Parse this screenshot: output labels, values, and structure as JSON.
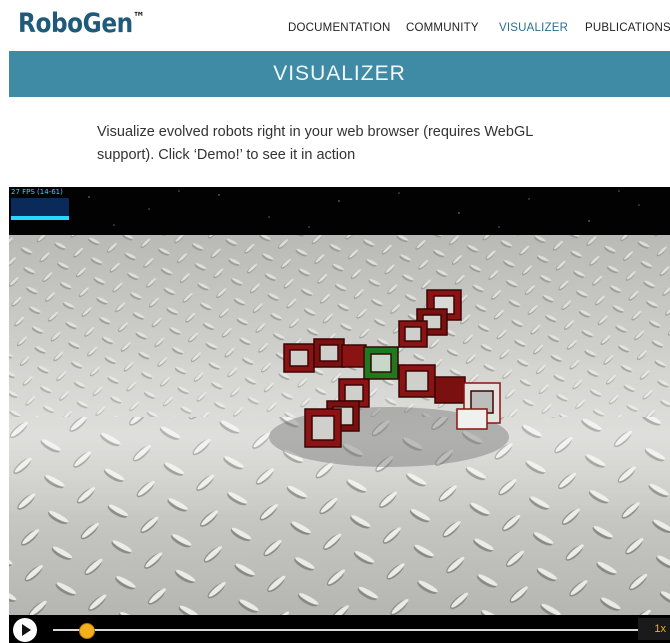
{
  "header": {
    "logo": "RoboGen",
    "logo_mark": "™",
    "nav": [
      "DOCUMENTATION",
      "COMMUNITY",
      "VISUALIZER",
      "PUBLICATIONS"
    ],
    "active": "VISUALIZER",
    "accent": "#2b6f8f"
  },
  "banner": {
    "title": "VISUALIZER",
    "color": "#3f8aa5"
  },
  "intro": {
    "text": "Visualize evolved robots right in your web browser (requires WebGL support). Click ‘Demo!’ to see it in action"
  },
  "viewer": {
    "fps_label": "27 FPS (14-61)"
  },
  "player": {
    "speed": "1x",
    "progress": 0.07,
    "play_icon": "play-icon"
  }
}
